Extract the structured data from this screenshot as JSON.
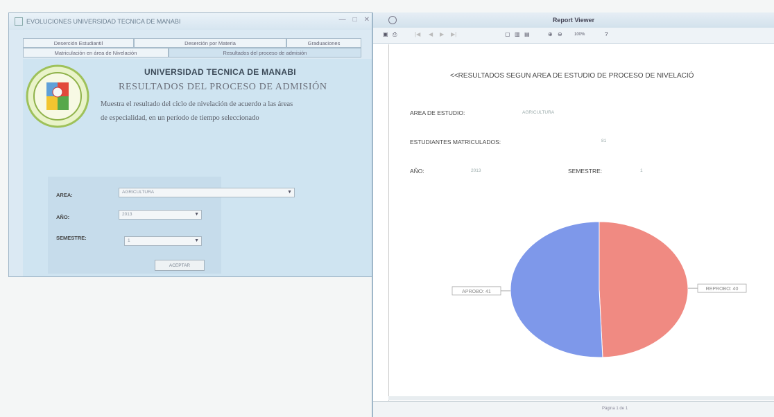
{
  "left_window": {
    "title": "EVOLUCIONES UNIVERSIDAD TECNICA DE MANABI",
    "tabs_row1": [
      "Deserción Estudiantil",
      "Deserción por Materia",
      "Graduaciones"
    ],
    "tabs_row2": [
      "Matriculación en área de Nivelación",
      "Resultados del proceso de admisión"
    ],
    "university": "UNIVERSIDAD TECNICA DE MANABI",
    "subtitle": "RESULTADOS DEL PROCESO DE ADMISIÓN",
    "description_line1": "Muestra el resultado del ciclo de nivelación de acuerdo a las áreas",
    "description_line2": "de especialidad, en un período de tiempo seleccionado",
    "form": {
      "area_label": "AREA:",
      "area_value": "AGRICULTURA",
      "anio_label": "AÑO:",
      "anio_value": "2013",
      "semestre_label": "SEMESTRE:",
      "semestre_value": "1",
      "accept_label": "ACEPTAR"
    }
  },
  "right_window": {
    "title": "Report Viewer",
    "toolbar_zoom": "100%",
    "report_title": "<<RESULTADOS SEGUN AREA DE ESTUDIO DE PROCESO DE NIVELACIÓ",
    "area_label": "AREA DE ESTUDIO:",
    "area_value": "AGRICULTURA",
    "matriculados_label": "ESTUDIANTES MATRICULADOS:",
    "matriculados_value": "81",
    "anio_label": "AÑO:",
    "anio_value": "2013",
    "semestre_label": "SEMESTRE:",
    "semestre_value": "1",
    "page_indicator": "Página 1 de 1"
  },
  "chart_data": {
    "type": "pie",
    "slices": [
      {
        "label": "REPROBO",
        "value": 40,
        "color": "#f08a82"
      },
      {
        "label": "APROBO",
        "value": 41,
        "color": "#7e98ea"
      }
    ],
    "legend": "none"
  },
  "colors": {
    "left_bg": "#cfe4f1",
    "pie_red": "#f08a82",
    "pie_blue": "#7e98ea"
  }
}
